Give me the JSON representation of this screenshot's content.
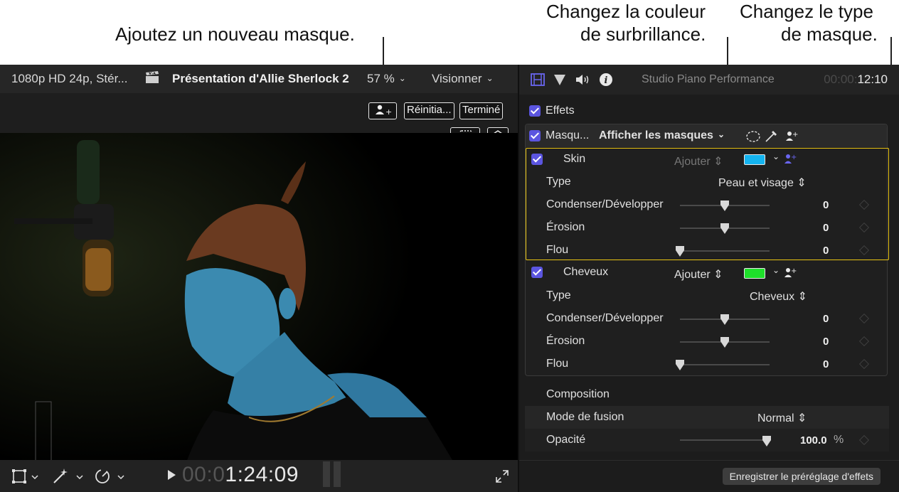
{
  "callouts": {
    "add_mask": "Ajoutez un nouveau masque.",
    "highlight_line1": "Changez la couleur",
    "highlight_line2": "de surbrillance.",
    "type_line1": "Changez le type",
    "type_line2": "de masque."
  },
  "viewer": {
    "format": "1080p HD 24p, Stér...",
    "project": "Présentation d'Allie Sherlock 2",
    "zoom": "57 %",
    "view_menu": "Visionner",
    "reset_button": "Réinitia...",
    "done_button": "Terminé",
    "timecode_dim": "00:0",
    "timecode": "1:24:09"
  },
  "inspector": {
    "clip_name": "Studio Piano Performance",
    "timecode_dim": "00:00:",
    "timecode": "12:10",
    "effects_label": "Effets",
    "mask_header_label": "Masqu...",
    "show_masks_menu": "Afficher les masques",
    "masks": [
      {
        "name": "Skin",
        "add_label": "Ajouter",
        "color": "#14b4f0",
        "type_label": "Type",
        "type_value": "Peau et visage",
        "params": [
          {
            "label": "Condenser/Développer",
            "value": "0",
            "level": 0.5
          },
          {
            "label": "Érosion",
            "value": "0",
            "level": 0.5
          },
          {
            "label": "Flou",
            "value": "0",
            "level": 0.0
          }
        ]
      },
      {
        "name": "Cheveux",
        "add_label": "Ajouter",
        "color": "#1ee02a",
        "type_label": "Type",
        "type_value": "Cheveux",
        "params": [
          {
            "label": "Condenser/Développer",
            "value": "0",
            "level": 0.5
          },
          {
            "label": "Érosion",
            "value": "0",
            "level": 0.5
          },
          {
            "label": "Flou",
            "value": "0",
            "level": 0.0
          }
        ]
      }
    ],
    "composition_label": "Composition",
    "blend_mode_label": "Mode de fusion",
    "blend_mode_value": "Normal",
    "opacity_label": "Opacité",
    "opacity_value": "100.0",
    "opacity_unit": "%",
    "save_preset_button": "Enregistrer le préréglage d'effets"
  },
  "colors": {
    "accent": "#5b55e0",
    "highlight_border": "#e9c413"
  }
}
